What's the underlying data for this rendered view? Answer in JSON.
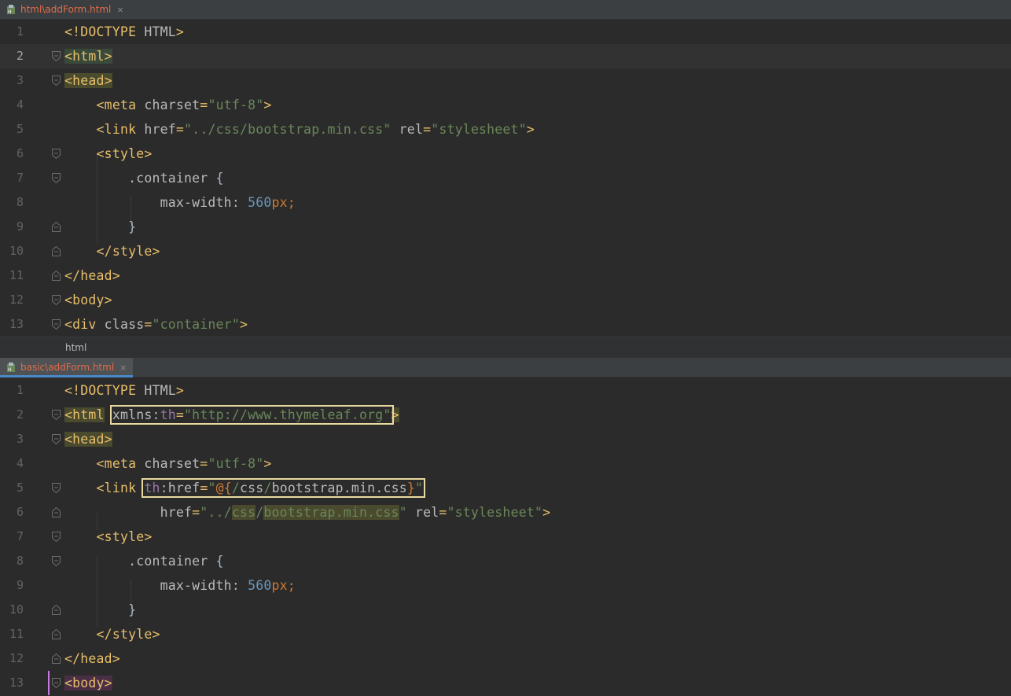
{
  "top_editor": {
    "tab": {
      "label": "html\\addForm.html",
      "close": "×"
    },
    "lines": [
      {
        "n": "1"
      },
      {
        "n": "2"
      },
      {
        "n": "3"
      },
      {
        "n": "4"
      },
      {
        "n": "5"
      },
      {
        "n": "6"
      },
      {
        "n": "7"
      },
      {
        "n": "8"
      },
      {
        "n": "9"
      },
      {
        "n": "10"
      },
      {
        "n": "11"
      },
      {
        "n": "12"
      },
      {
        "n": "13"
      }
    ],
    "breadcrumb": "html"
  },
  "bottom_editor": {
    "tab": {
      "label": "basic\\addForm.html",
      "close": "×"
    },
    "lines": [
      {
        "n": "1"
      },
      {
        "n": "2"
      },
      {
        "n": "3"
      },
      {
        "n": "4"
      },
      {
        "n": "5"
      },
      {
        "n": "6"
      },
      {
        "n": "7"
      },
      {
        "n": "8"
      },
      {
        "n": "9"
      },
      {
        "n": "10"
      },
      {
        "n": "11"
      },
      {
        "n": "12"
      },
      {
        "n": "13"
      }
    ]
  },
  "colors": {
    "tag": "#e8bf6a",
    "attr": "#bababa",
    "string": "#6a8759",
    "number": "#6897bb",
    "keyword": "#cc7832",
    "namespace": "#9876aa",
    "background": "#2b2b2b"
  }
}
